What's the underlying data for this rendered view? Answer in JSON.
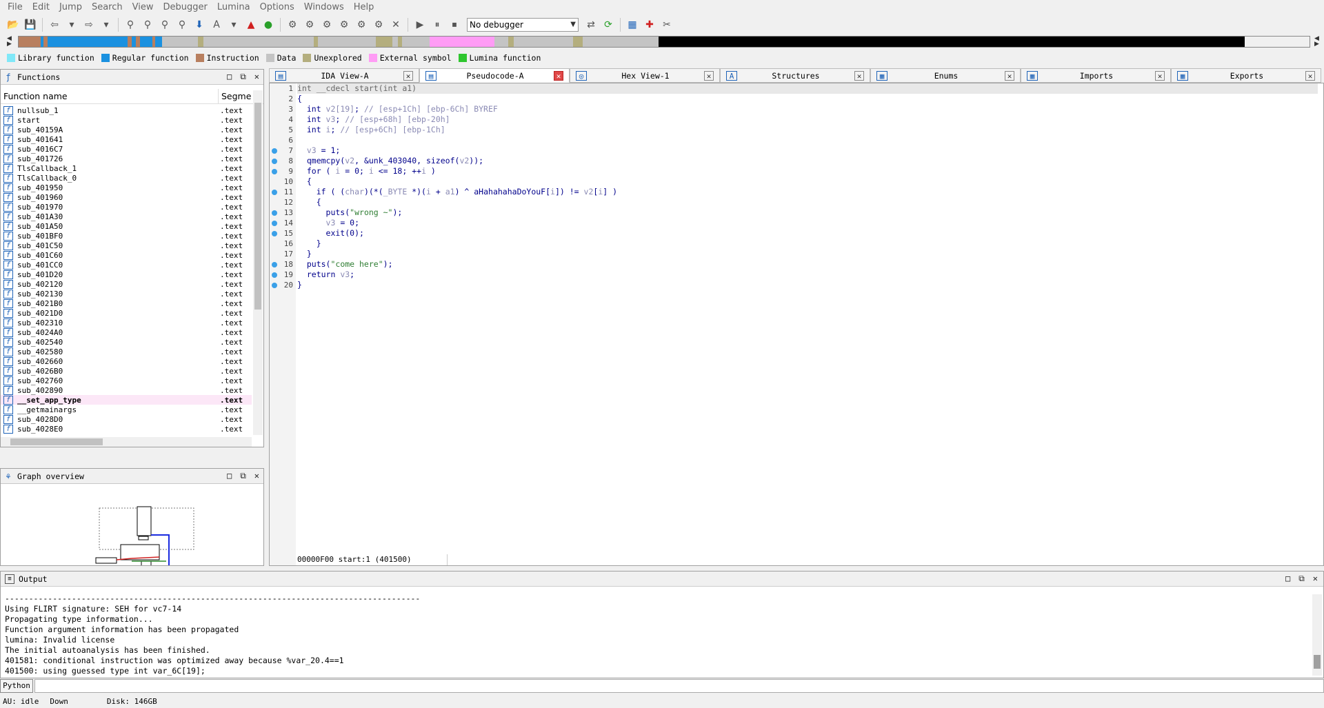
{
  "menu": [
    "File",
    "Edit",
    "Jump",
    "Search",
    "View",
    "Debugger",
    "Lumina",
    "Options",
    "Windows",
    "Help"
  ],
  "toolbar": {
    "debugger_select": "No debugger"
  },
  "nav_colors": {
    "library": "#80e8f8",
    "regular": "#1b91e0",
    "instruction": "#b87f5f",
    "data": "#c4c4c4",
    "unexplored": "#b4ae7e",
    "external": "#ff9cf5",
    "lumina": "#2fc62f",
    "black": "#000000"
  },
  "legend": [
    {
      "label": "Library function",
      "color": "#80e8f8"
    },
    {
      "label": "Regular function",
      "color": "#1b91e0"
    },
    {
      "label": "Instruction",
      "color": "#b87f5f"
    },
    {
      "label": "Data",
      "color": "#c4c4c4"
    },
    {
      "label": "Unexplored",
      "color": "#b4ae7e"
    },
    {
      "label": "External symbol",
      "color": "#ff9cf5"
    },
    {
      "label": "Lumina function",
      "color": "#2fc62f"
    }
  ],
  "functions": {
    "title": "Functions",
    "col_name": "Function name",
    "col_segment": "Segme",
    "rows": [
      {
        "name": "nullsub_1",
        "seg": ".text"
      },
      {
        "name": "start",
        "seg": ".text"
      },
      {
        "name": "sub_40159A",
        "seg": ".text"
      },
      {
        "name": "sub_401641",
        "seg": ".text"
      },
      {
        "name": "sub_4016C7",
        "seg": ".text"
      },
      {
        "name": "sub_401726",
        "seg": ".text"
      },
      {
        "name": "TlsCallback_1",
        "seg": ".text"
      },
      {
        "name": "TlsCallback_0",
        "seg": ".text"
      },
      {
        "name": "sub_401950",
        "seg": ".text"
      },
      {
        "name": "sub_401960",
        "seg": ".text"
      },
      {
        "name": "sub_401970",
        "seg": ".text"
      },
      {
        "name": "sub_401A30",
        "seg": ".text"
      },
      {
        "name": "sub_401A50",
        "seg": ".text"
      },
      {
        "name": "sub_401BF0",
        "seg": ".text"
      },
      {
        "name": "sub_401C50",
        "seg": ".text"
      },
      {
        "name": "sub_401C60",
        "seg": ".text"
      },
      {
        "name": "sub_401CC0",
        "seg": ".text"
      },
      {
        "name": "sub_401D20",
        "seg": ".text"
      },
      {
        "name": "sub_402120",
        "seg": ".text"
      },
      {
        "name": "sub_402130",
        "seg": ".text"
      },
      {
        "name": "sub_4021B0",
        "seg": ".text"
      },
      {
        "name": "sub_4021D0",
        "seg": ".text"
      },
      {
        "name": "sub_402310",
        "seg": ".text"
      },
      {
        "name": "sub_4024A0",
        "seg": ".text"
      },
      {
        "name": "sub_402540",
        "seg": ".text"
      },
      {
        "name": "sub_402580",
        "seg": ".text"
      },
      {
        "name": "sub_402660",
        "seg": ".text"
      },
      {
        "name": "sub_4026B0",
        "seg": ".text"
      },
      {
        "name": "sub_402760",
        "seg": ".text"
      },
      {
        "name": "sub_402890",
        "seg": ".text"
      },
      {
        "name": "__set_app_type",
        "seg": ".text",
        "hl": true
      },
      {
        "name": "__getmainargs",
        "seg": ".text"
      },
      {
        "name": "sub_4028D0",
        "seg": ".text"
      },
      {
        "name": "sub_4028E0",
        "seg": ".text"
      }
    ]
  },
  "graph": {
    "title": "Graph overview"
  },
  "tabs": [
    {
      "label": "IDA View-A",
      "active": false
    },
    {
      "label": "Pseudocode-A",
      "active": true
    },
    {
      "label": "Hex View-1",
      "active": false
    },
    {
      "label": "Structures",
      "active": false
    },
    {
      "label": "Enums",
      "active": false
    },
    {
      "label": "Imports",
      "active": false
    },
    {
      "label": "Exports",
      "active": false
    }
  ],
  "code": {
    "line_numbers": [
      "1",
      "2",
      "3",
      "4",
      "5",
      "6",
      "7",
      "8",
      "9",
      "10",
      "11",
      "12",
      "13",
      "14",
      "15",
      "16",
      "17",
      "18",
      "19",
      "20"
    ],
    "dot_lines": [
      7,
      8,
      9,
      11,
      13,
      14,
      15,
      18,
      19,
      20
    ],
    "lines": [
      [
        {
          "t": "int __cdecl start(int a1)",
          "c": ""
        }
      ],
      [
        {
          "t": "{",
          "c": "navy"
        }
      ],
      [
        {
          "t": "  int ",
          "c": "navy"
        },
        {
          "t": "v2[19]",
          "c": "grey"
        },
        {
          "t": "; ",
          "c": "navy"
        },
        {
          "t": "// [esp+1Ch] [ebp-6Ch] BYREF",
          "c": "com"
        }
      ],
      [
        {
          "t": "  int ",
          "c": "navy"
        },
        {
          "t": "v3",
          "c": "grey"
        },
        {
          "t": "; ",
          "c": "navy"
        },
        {
          "t": "// [esp+68h] [ebp-20h]",
          "c": "com"
        }
      ],
      [
        {
          "t": "  int ",
          "c": "navy"
        },
        {
          "t": "i",
          "c": "grey"
        },
        {
          "t": "; ",
          "c": "navy"
        },
        {
          "t": "// [esp+6Ch] [ebp-1Ch]",
          "c": "com"
        }
      ],
      [
        {
          "t": "",
          "c": ""
        }
      ],
      [
        {
          "t": "  v3",
          "c": "grey"
        },
        {
          "t": " = 1;",
          "c": "navy"
        }
      ],
      [
        {
          "t": "  qmemcpy(",
          "c": "navy"
        },
        {
          "t": "v2",
          "c": "grey"
        },
        {
          "t": ", &unk_403040, sizeof(",
          "c": "navy"
        },
        {
          "t": "v2",
          "c": "grey"
        },
        {
          "t": "));",
          "c": "navy"
        }
      ],
      [
        {
          "t": "  for ( ",
          "c": "navy"
        },
        {
          "t": "i",
          "c": "grey"
        },
        {
          "t": " = 0; ",
          "c": "navy"
        },
        {
          "t": "i",
          "c": "grey"
        },
        {
          "t": " <= 18; ++",
          "c": "navy"
        },
        {
          "t": "i",
          "c": "grey"
        },
        {
          "t": " )",
          "c": "navy"
        }
      ],
      [
        {
          "t": "  {",
          "c": "navy"
        }
      ],
      [
        {
          "t": "    if ( (",
          "c": "navy"
        },
        {
          "t": "char",
          "c": "grey"
        },
        {
          "t": ")(*(",
          "c": "navy"
        },
        {
          "t": "_BYTE",
          "c": "grey"
        },
        {
          "t": " *)(",
          "c": "navy"
        },
        {
          "t": "i",
          "c": "grey"
        },
        {
          "t": " + ",
          "c": "navy"
        },
        {
          "t": "a1",
          "c": "grey"
        },
        {
          "t": ") ^ aHahahahaDoYouF[",
          "c": "navy"
        },
        {
          "t": "i",
          "c": "grey"
        },
        {
          "t": "]) != ",
          "c": "navy"
        },
        {
          "t": "v2",
          "c": "grey"
        },
        {
          "t": "[",
          "c": "navy"
        },
        {
          "t": "i",
          "c": "grey"
        },
        {
          "t": "] )",
          "c": "navy"
        }
      ],
      [
        {
          "t": "    {",
          "c": "navy"
        }
      ],
      [
        {
          "t": "      puts(",
          "c": "navy"
        },
        {
          "t": "\"wrong ~\"",
          "c": "gn"
        },
        {
          "t": ");",
          "c": "navy"
        }
      ],
      [
        {
          "t": "      v3",
          "c": "grey"
        },
        {
          "t": " = 0;",
          "c": "navy"
        }
      ],
      [
        {
          "t": "      exit(0);",
          "c": "navy"
        }
      ],
      [
        {
          "t": "    }",
          "c": "navy"
        }
      ],
      [
        {
          "t": "  }",
          "c": "navy"
        }
      ],
      [
        {
          "t": "  puts(",
          "c": "navy"
        },
        {
          "t": "\"come here\"",
          "c": "gn"
        },
        {
          "t": ");",
          "c": "navy"
        }
      ],
      [
        {
          "t": "  return ",
          "c": "navy"
        },
        {
          "t": "v3",
          "c": "grey"
        },
        {
          "t": ";",
          "c": "navy"
        }
      ],
      [
        {
          "t": "}",
          "c": "navy"
        }
      ]
    ],
    "status": "00000F00 start:1 (401500)"
  },
  "output": {
    "title": "Output",
    "lines": [
      "---------------------------------------------------------------------------------------",
      "Using FLIRT signature: SEH for vc7-14",
      "Propagating type information...",
      "Function argument information has been propagated",
      "lumina: Invalid license",
      "The initial autoanalysis has been finished.",
      "401581: conditional instruction was optimized away because %var_20.4==1",
      "401500: using guessed type int var_6C[19];"
    ]
  },
  "python": {
    "label": "Python"
  },
  "status": {
    "au": "AU:",
    "state": "idle",
    "dir": "Down",
    "disk": "Disk: 146GB"
  }
}
